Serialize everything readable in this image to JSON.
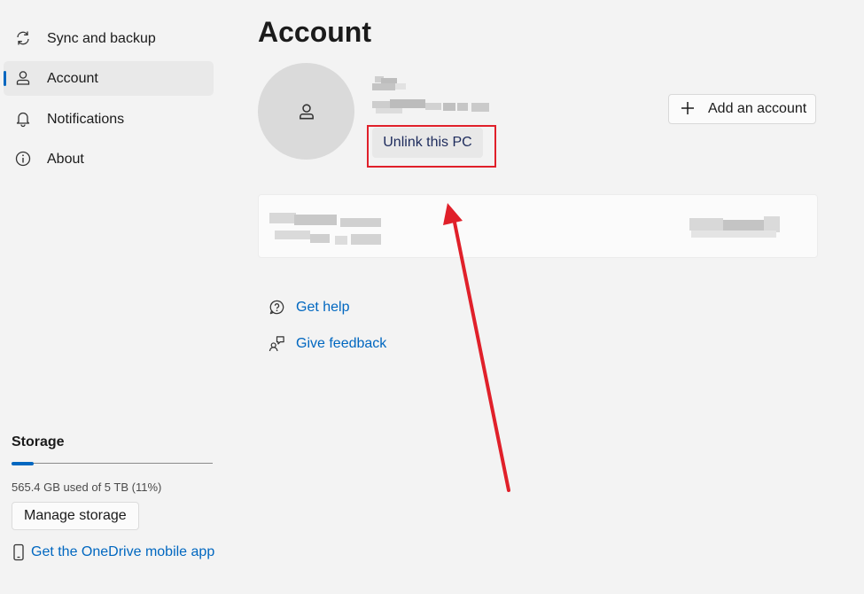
{
  "sidebar": {
    "items": [
      {
        "label": "Sync and backup",
        "icon": "sync-icon"
      },
      {
        "label": "Account",
        "icon": "person-icon",
        "active": true
      },
      {
        "label": "Notifications",
        "icon": "bell-icon"
      },
      {
        "label": "About",
        "icon": "info-icon"
      }
    ],
    "storage": {
      "title": "Storage",
      "usage_text": "565.4 GB used of 5 TB (11%)",
      "usage_fraction": 0.11,
      "manage_label": "Manage storage",
      "mobile_app_label": "Get the OneDrive mobile app"
    }
  },
  "main": {
    "title": "Account",
    "unlink_label": "Unlink this PC",
    "add_account_label": "Add an account",
    "help_links": [
      {
        "label": "Get help",
        "icon": "help-icon"
      },
      {
        "label": "Give feedback",
        "icon": "feedback-icon"
      }
    ]
  },
  "colors": {
    "accent": "#0067c0",
    "annotation": "#e0202a",
    "background": "#f3f3f3"
  }
}
